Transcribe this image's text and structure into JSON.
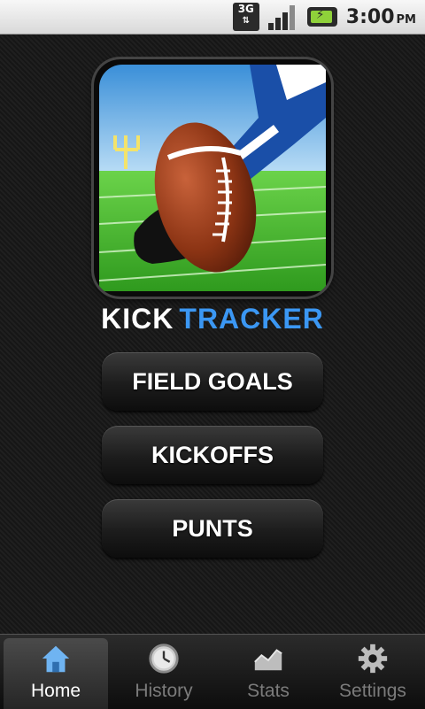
{
  "status_bar": {
    "network": "3G",
    "time": "3:00",
    "ampm": "PM",
    "icons": [
      "network-3g-icon",
      "signal-icon",
      "battery-charging-icon"
    ]
  },
  "app": {
    "title_part1": "KICK",
    "title_part2": "TRACKER",
    "colors": {
      "accent": "#3b97f3",
      "background": "#141414"
    }
  },
  "menu": {
    "field_goals": "FIELD GOALS",
    "kickoffs": "KICKOFFS",
    "punts": "PUNTS"
  },
  "tabs": [
    {
      "label": "Home",
      "icon": "home-icon",
      "active": true
    },
    {
      "label": "History",
      "icon": "clock-icon",
      "active": false
    },
    {
      "label": "Stats",
      "icon": "chart-icon",
      "active": false
    },
    {
      "label": "Settings",
      "icon": "gear-icon",
      "active": false
    }
  ]
}
